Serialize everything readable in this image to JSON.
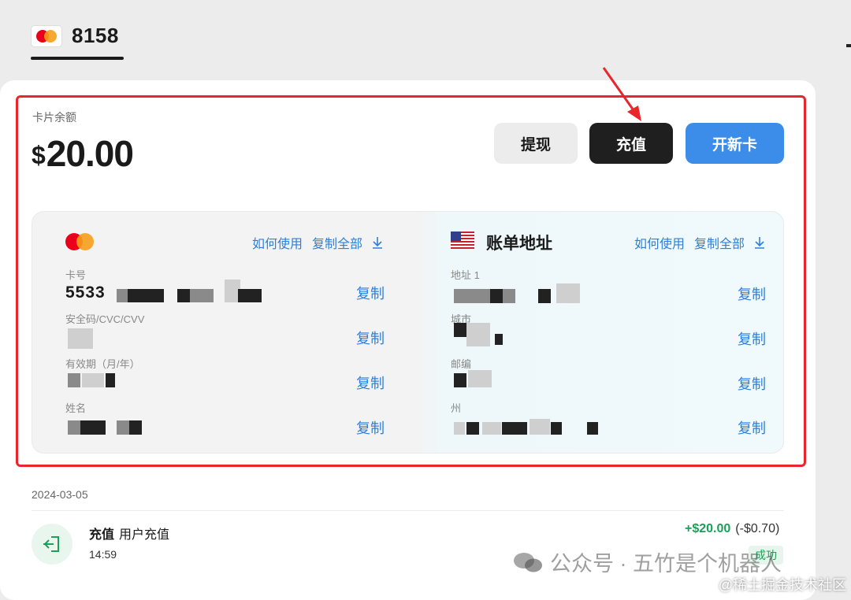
{
  "header": {
    "card_last4": "8158"
  },
  "balance": {
    "label": "卡片余额",
    "currency": "$",
    "amount": "20.00"
  },
  "actions": {
    "withdraw": "提现",
    "topup": "充值",
    "new_card": "开新卡"
  },
  "card_info": {
    "how_to_use": "如何使用",
    "copy_all": "复制全部",
    "fields": [
      {
        "label": "卡号",
        "value_prefix": "5533",
        "copy": "复制"
      },
      {
        "label": "安全码/CVC/CVV",
        "copy": "复制"
      },
      {
        "label": "有效期（月/年）",
        "copy": "复制"
      },
      {
        "label": "姓名",
        "copy": "复制"
      }
    ]
  },
  "billing": {
    "title": "账单地址",
    "how_to_use": "如何使用",
    "copy_all": "复制全部",
    "fields": [
      {
        "label": "地址 1",
        "copy": "复制"
      },
      {
        "label": "城市",
        "copy": "复制"
      },
      {
        "label": "邮编",
        "copy": "复制"
      },
      {
        "label": "州",
        "copy": "复制"
      }
    ]
  },
  "transactions": {
    "date": "2024-03-05",
    "items": [
      {
        "type": "充值",
        "desc": "用户充值",
        "time": "14:59",
        "amount": "+$20.00",
        "fee": "(-$0.70)",
        "status": "成功"
      }
    ]
  },
  "watermark": {
    "primary": "公众号 · 五竹是个机器人",
    "secondary": "@稀土掘金技术社区"
  },
  "colors": {
    "accent_blue": "#3c8de9",
    "link_blue": "#2d7fdc",
    "highlight_red": "#e8262c",
    "success_green": "#1aa058",
    "dark_button": "#1f1f1f"
  }
}
